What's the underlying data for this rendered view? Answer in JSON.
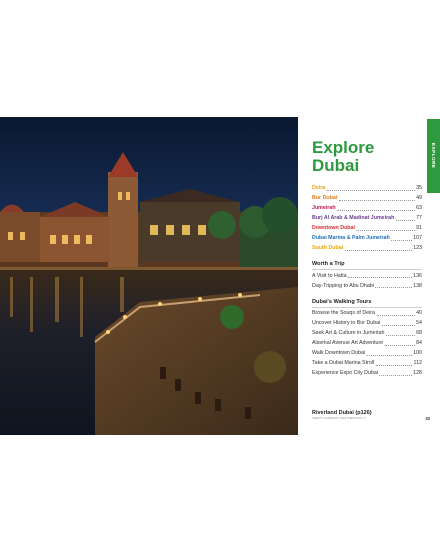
{
  "title_lines": [
    "Explore",
    "Dubai"
  ],
  "side_tab": "EXPLORE",
  "neighbourhoods": [
    {
      "label": "Deira",
      "page": "35",
      "color": "#e8a317"
    },
    {
      "label": "Bur Dubai",
      "page": "49",
      "color": "#e07b1a"
    },
    {
      "label": "Jumeirah",
      "page": "63",
      "color": "#c2185b"
    },
    {
      "label": "Burj Al Arab & Madinat Jumeirah",
      "page": "77",
      "color": "#6a3d8f"
    },
    {
      "label": "Downtown Dubai",
      "page": "91",
      "color": "#d32f2f"
    },
    {
      "label": "Dubai Marina & Palm Jumeirah",
      "page": "107",
      "color": "#1e6fb5"
    },
    {
      "label": "South Dubai",
      "page": "123",
      "color": "#f0a500"
    }
  ],
  "worth_a_trip": {
    "heading": "Worth a Trip",
    "items": [
      {
        "label": "A Visit to Hatta",
        "page": "136"
      },
      {
        "label": "Day-Tripping to Abu Dhabi",
        "page": "138"
      }
    ]
  },
  "walking_tours": {
    "heading": "Dubai's Walking Tours",
    "items": [
      {
        "label": "Browse the Souqs of Deira",
        "page": "40"
      },
      {
        "label": "Uncover History in Bur Dubai",
        "page": "54"
      },
      {
        "label": "Seek Art & Culture in Jumeirah",
        "page": "68"
      },
      {
        "label": "Alserkal Avenue Art Adventure",
        "page": "84"
      },
      {
        "label": "Walk Downtown Dubai",
        "page": "100"
      },
      {
        "label": "Take a Dubai Marina Stroll",
        "page": "112"
      },
      {
        "label": "Experience Expo City Dubai",
        "page": "128"
      }
    ]
  },
  "caption": "Riverland Dubai (p126)",
  "credit": "CREDIT: GUARDIAN / SHUTTERSTOCK ©",
  "page_number": "33",
  "accent_color": "#2d9a3f"
}
